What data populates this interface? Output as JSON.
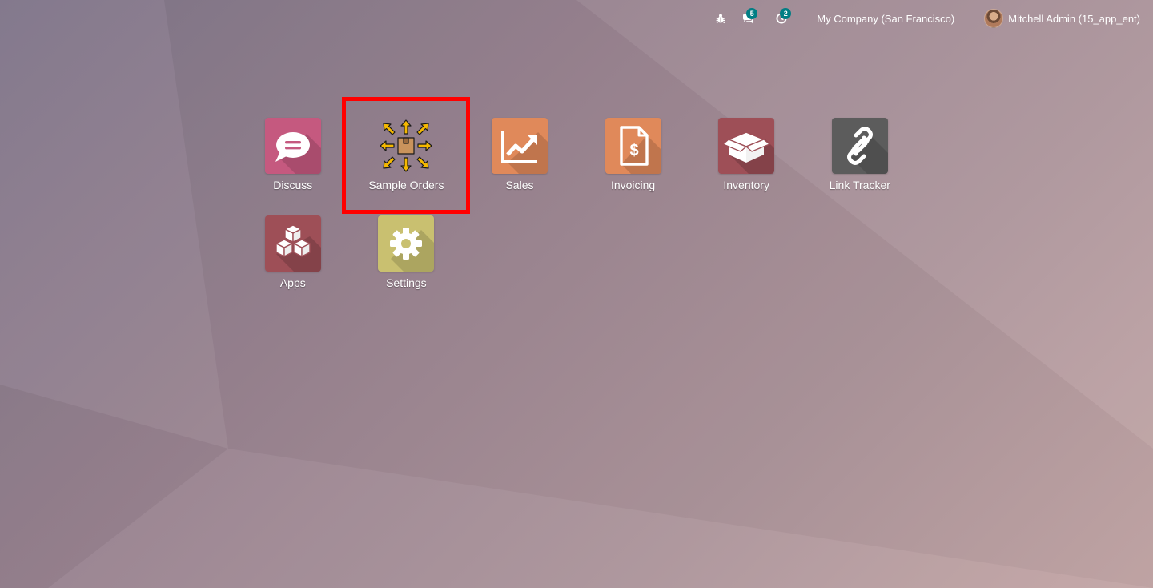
{
  "systray": {
    "debug_icon": "bug-icon",
    "messages_icon": "chat-icon",
    "messages_count": "5",
    "activities_icon": "clock-icon",
    "activities_count": "2",
    "company": "My Company (San Francisco)",
    "user_name": "Mitchell Admin (15_app_ent)"
  },
  "apps": [
    {
      "label": "Discuss",
      "icon": "discuss-icon",
      "color": "#c5597f"
    },
    {
      "label": "Sample Orders",
      "icon": "sample-orders-icon",
      "color": "transparent"
    },
    {
      "label": "Sales",
      "icon": "sales-icon",
      "color": "#e0895a"
    },
    {
      "label": "Invoicing",
      "icon": "invoicing-icon",
      "color": "#e0895a"
    },
    {
      "label": "Inventory",
      "icon": "inventory-icon",
      "color": "#9e4f57"
    },
    {
      "label": "Link Tracker",
      "icon": "link-tracker-icon",
      "color": "#5c5c5c"
    },
    {
      "label": "Apps",
      "icon": "apps-icon",
      "color": "#9e4f57"
    },
    {
      "label": "Settings",
      "icon": "settings-icon",
      "color": "#c9c070"
    }
  ],
  "highlight": {
    "target": "Sample Orders",
    "color": "#ff0000"
  }
}
